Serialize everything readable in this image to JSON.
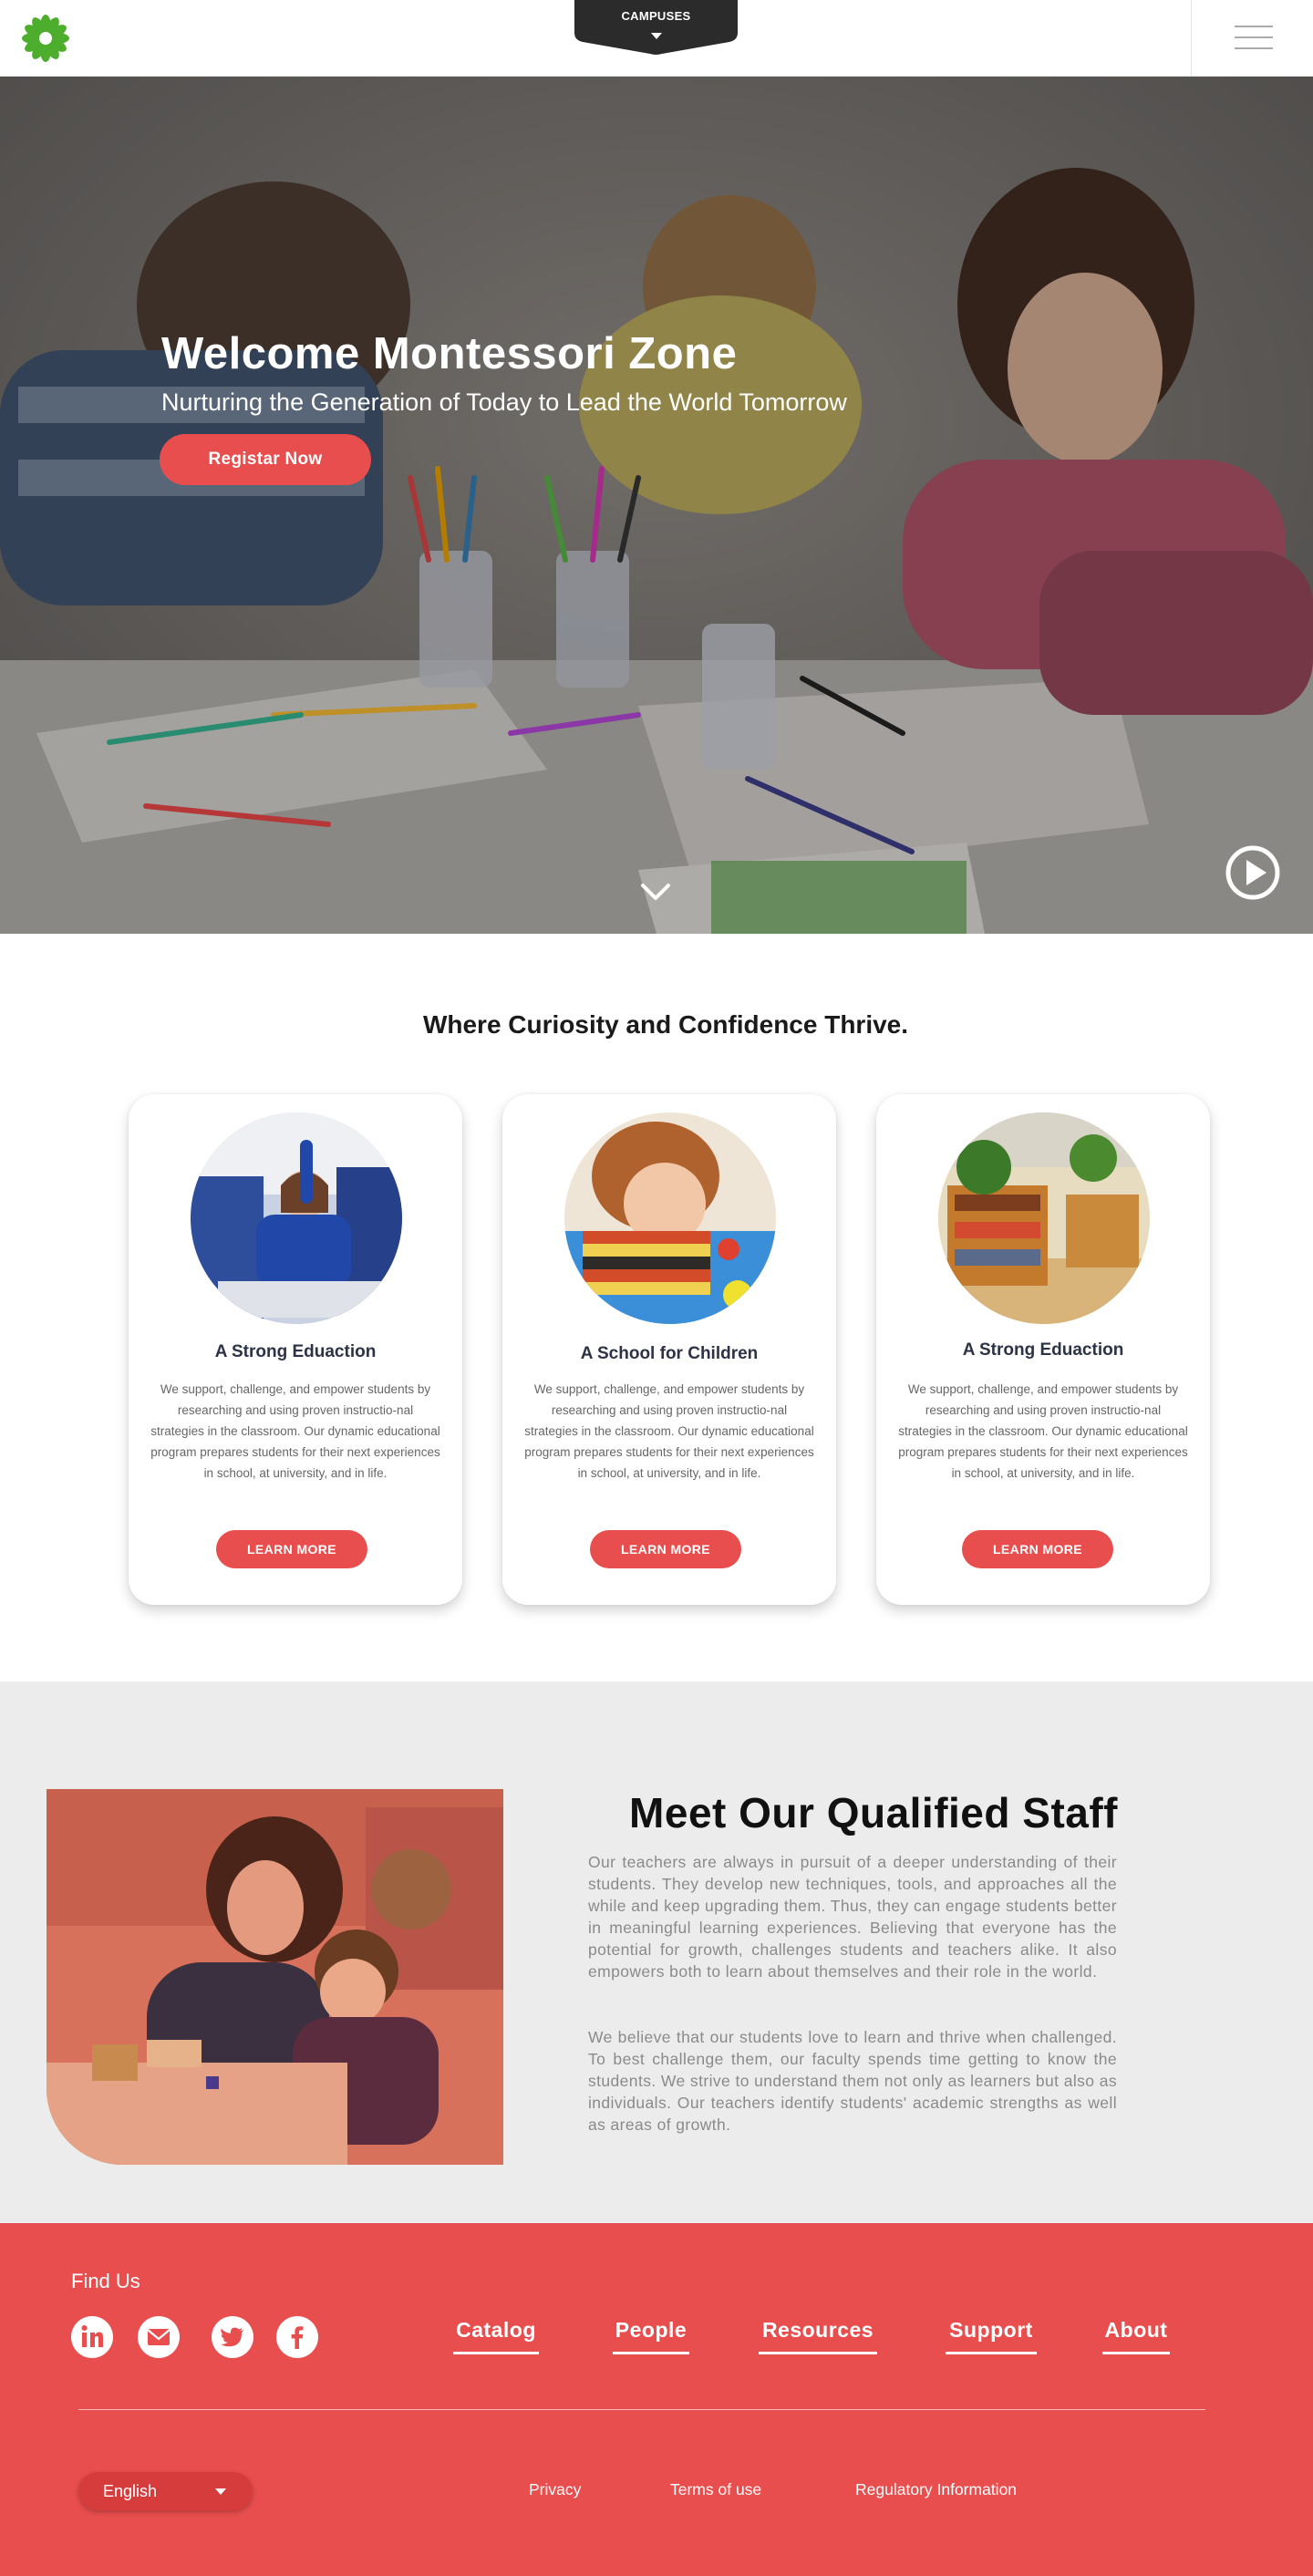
{
  "header": {
    "campus_label": "CAMPUSES"
  },
  "hero": {
    "title": "Welcome Montessori Zone",
    "subtitle": "Nurturing the Generation of Today to Lead the World Tomorrow",
    "cta_label": "Registar Now"
  },
  "features": {
    "title": "Where Curiosity and Confidence Thrive.",
    "cards": [
      {
        "title": "A Strong Eduaction",
        "text": "We support, challenge, and empower students by researching and using proven instructio-nal strategies in the classroom.  Our dynamic educational program prepares students for their next experiences in school, at university, and in life.",
        "button": "LEARN MORE"
      },
      {
        "title": "A School for Children",
        "text": "We support, challenge, and empower students by researching and using proven instructio-nal strategies in the classroom.  Our dynamic educational program prepares students for their next experiences in school, at university, and in life.",
        "button": "LEARN MORE"
      },
      {
        "title": "A Strong Eduaction",
        "text": "We support, challenge, and empower students by researching and using proven instructio-nal strategies in the classroom.  Our dynamic educational program prepares students for their next experiences in school, at university, and in life.",
        "button": "LEARN MORE"
      }
    ]
  },
  "staff": {
    "title": "Meet Our Qualified Staff",
    "paragraph1": "Our teachers are always in pursuit of a deeper understanding of their students. They develop new techniques, tools, and approaches all the while and keep upgrading them. Thus, they can engage students better in meaningful learning experiences. Believing that everyone has the potential for growth, challenges students and teachers alike. It also empowers both to learn about themselves and their role in the world.",
    "paragraph2": "We believe that our students love to learn and thrive when challenged. To best challenge them, our faculty spends time getting to know the students. We strive to understand them not only as learners but also as individuals. Our teachers identify students' academic strengths as well as areas of growth."
  },
  "footer": {
    "find_us": "Find Us",
    "social_icons": [
      "linkedin-icon",
      "mail-icon",
      "twitter-icon",
      "facebook-icon"
    ],
    "nav": [
      "Catalog",
      "People",
      "Resources",
      "Support",
      "About"
    ],
    "language": "English",
    "legal": [
      "Privacy",
      "Terms of use",
      "Regulatory Information"
    ]
  },
  "colors": {
    "accent": "#e94e4e",
    "footer_bg": "#e94e4e",
    "dark_tab": "#2b2b2b",
    "logo_green": "#4cae2c"
  }
}
